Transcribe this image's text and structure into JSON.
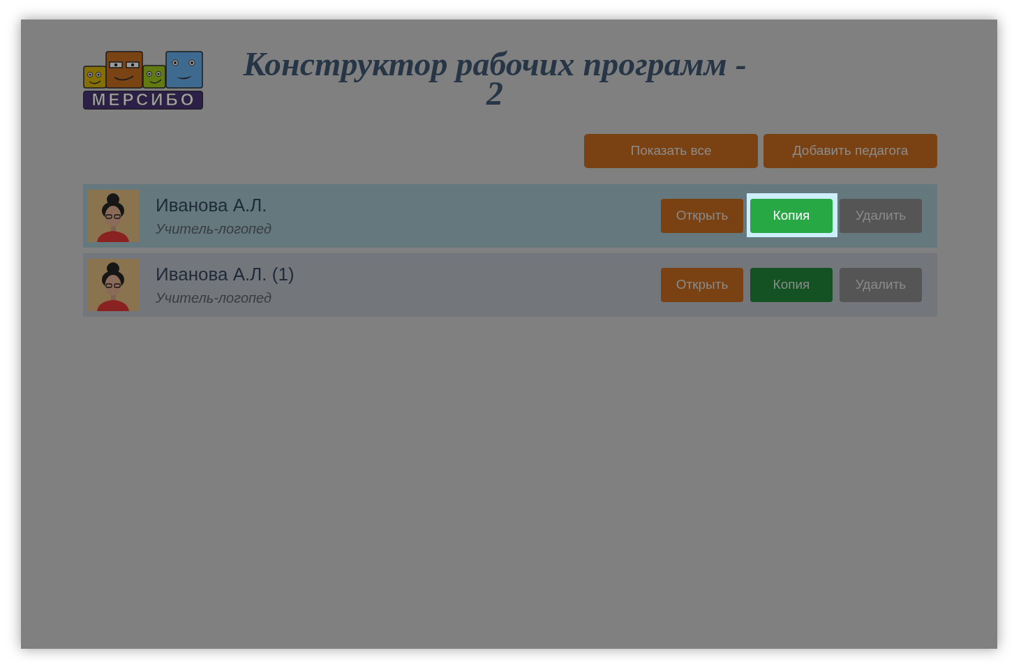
{
  "header": {
    "logo": {
      "wordmark": "МЕРСИБО"
    },
    "title": "Конструктор рабочих программ - 2"
  },
  "toolbar": {
    "buttons": [
      {
        "label": "Показать все"
      },
      {
        "label": "Добавить педагога"
      }
    ]
  },
  "teachers": [
    {
      "name": "Иванова А.Л.",
      "role": "Учитель-логопед",
      "selected": true,
      "actions": [
        {
          "kind": "open",
          "label": "Открыть",
          "highlighted": false
        },
        {
          "kind": "copy",
          "label": "Копия",
          "highlighted": true
        },
        {
          "kind": "delete",
          "label": "Удалить",
          "highlighted": false
        }
      ]
    },
    {
      "name": "Иванова А.Л. (1)",
      "role": "Учитель-логопед",
      "selected": false,
      "actions": [
        {
          "kind": "open",
          "label": "Открыть",
          "highlighted": false
        },
        {
          "kind": "copy",
          "label": "Копия",
          "highlighted": false
        },
        {
          "kind": "delete",
          "label": "Удалить",
          "highlighted": false
        }
      ]
    }
  ]
}
